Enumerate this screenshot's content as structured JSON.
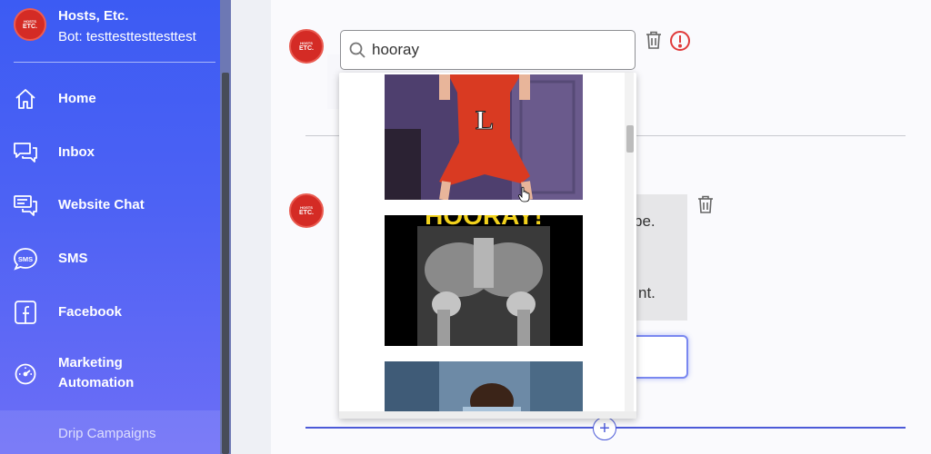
{
  "sidebar": {
    "brand_name": "Hosts, Etc.",
    "bot_label": "Bot: testtesttesttesttest",
    "logo_text_small": "HOSTS",
    "logo_text": "ETC.",
    "items": [
      {
        "label": "Home",
        "icon": "home-icon"
      },
      {
        "label": "Inbox",
        "icon": "inbox-icon"
      },
      {
        "label": "Website Chat",
        "icon": "website-chat-icon"
      },
      {
        "label": "SMS",
        "icon": "sms-icon"
      },
      {
        "label": "Facebook",
        "icon": "facebook-icon"
      },
      {
        "label": "Marketing Automation",
        "icon": "gauge-icon"
      }
    ],
    "sub_item": "Drip Campaigns"
  },
  "search": {
    "value": "hooray",
    "icon": "search-icon"
  },
  "gif_results": [
    {
      "name": "cheerleader-gif",
      "caption": "L"
    },
    {
      "name": "hooray-xray-gif",
      "caption": "HOORAY!"
    },
    {
      "name": "office-man-gif",
      "caption": ""
    }
  ],
  "message": {
    "text_line_1": "pe.",
    "text_line_2": "nt."
  },
  "colors": {
    "sidebar_top": "#3c5bf3",
    "sidebar_bottom": "#6d6ef6",
    "accent": "#4c5ad8",
    "alert": "#e03a3a",
    "avatar_red": "#d42b25"
  }
}
